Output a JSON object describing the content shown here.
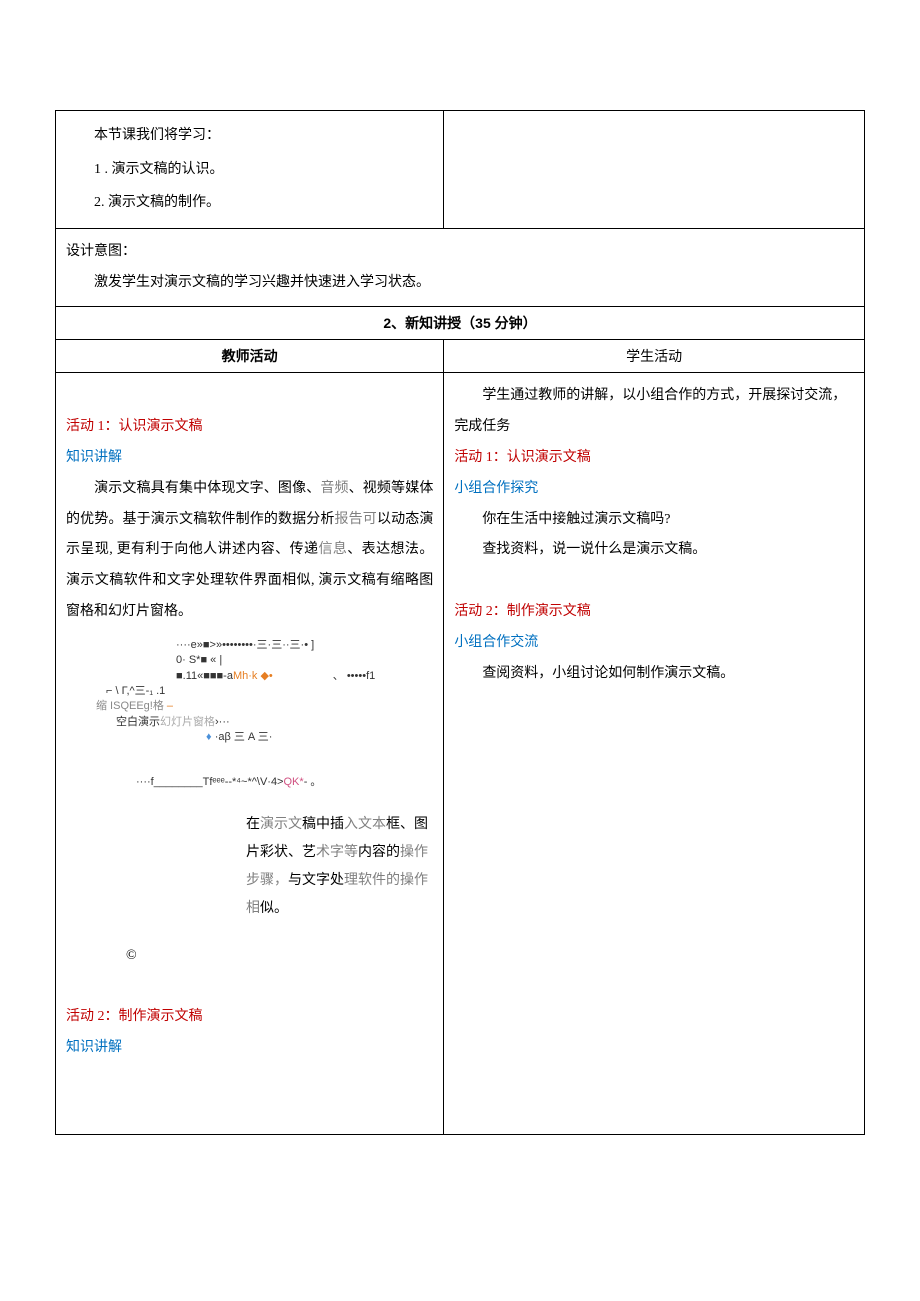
{
  "topLeft": {
    "line1": "本节课我们将学习：",
    "line2": "1 . 演示文稿的认识。",
    "line3": "2. 演示文稿的制作。"
  },
  "intent": {
    "label": "设计意图：",
    "text": "激发学生对演示文稿的学习兴趣并快速进入学习状态。"
  },
  "section2Header": "2、新知讲授（35 分钟）",
  "colHeaders": {
    "left": "教师活动",
    "right": "学生活动"
  },
  "teacher": {
    "act1Title": "活动 1：认识演示文稿",
    "knowledge": "知识讲解",
    "para1a": "演示文稿具有集中体现文字、图像、",
    "para1_audio": "音频",
    "para1b": "、视频等媒体的优势。基于演示文稿软件制作的数据分析",
    "para1_report": "报告可",
    "para1c": "以动态演示呈现, 更有利于向他人讲述内容、传递",
    "para1_info": "信息",
    "para1d": "、表达想法。演示文稿软件和文字处理软件界面相似, 演示文稿有缩略图窗格和幻灯片窗格。",
    "diagram": {
      "r1": "····e»■>»••••••••·三·三··三·•           ]",
      "r2": "0·      S*■                      «      |",
      "r3a": "■.11«■■■-a",
      "r3b": "Mh·k     ◆•",
      "r3c": "、  •••••f1",
      "r4": "⌐       \\        Γ,^三-₁                               .1",
      "r5a": "缩 ISQEEg!格",
      "r5b": "  –",
      "r6a": "空白演示",
      "r6b": "幻灯片窗格",
      "r6c": "›···",
      "r6d": "♦",
      "r6e": "·aβ 三 A 三·",
      "r7a": "····f________Tfᵉᵉᵉ--*⁴~*^\\V·4>",
      "r7b": "QK*",
      "r7c": "-  。"
    },
    "note": {
      "a": "在",
      "b": "演示文",
      "c": "稿中插",
      "d": "入文本",
      "e": "框、图片彩状、艺",
      "f": "术字等",
      "g": "内容的",
      "h": "操作步骤，",
      "i": "与文字处",
      "j": "理软件的操作相",
      "k": "似。"
    },
    "copyright": "©",
    "act2Title": "活动 2：制作演示文稿",
    "knowledge2": "知识讲解"
  },
  "student": {
    "intro": "学生通过教师的讲解，以小组合作的方式，开展探讨交流，完成任务",
    "act1Title": "活动 1：认识演示文稿",
    "groupExplore": "小组合作探究",
    "q1": "你在生活中接触过演示文稿吗?",
    "q2": "查找资料，说一说什么是演示文稿。",
    "act2Title": "活动 2：制作演示文稿",
    "groupExchange": "小组合作交流",
    "q3": "查阅资料，小组讨论如何制作演示文稿。"
  }
}
